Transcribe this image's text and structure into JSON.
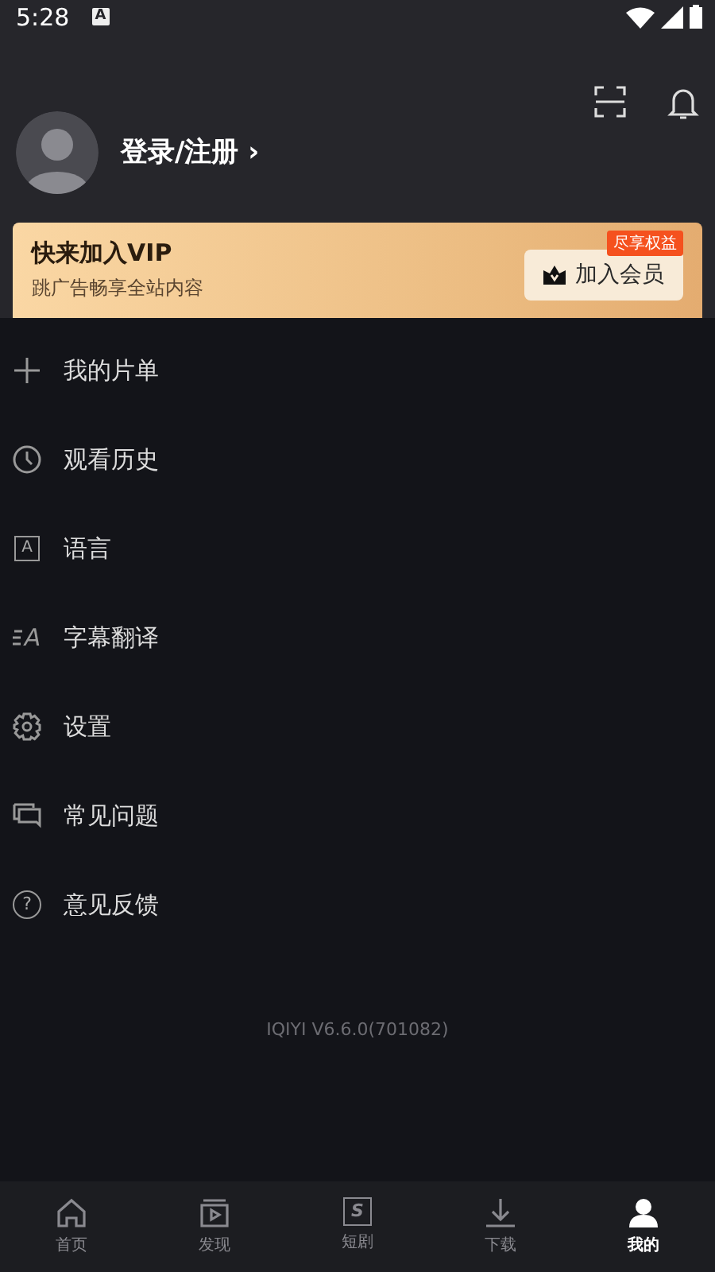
{
  "status_bar": {
    "time": "5:28",
    "notification_glyph": "A"
  },
  "profile": {
    "login": "登录/注册",
    "chevron": "›"
  },
  "vip_card": {
    "title": "快来加入VIP",
    "subtitle": "跳广告畅享全站内容",
    "badge": "尽享权益",
    "button": "加入会员"
  },
  "menu": [
    {
      "kind": "plus",
      "label": "我的片单"
    },
    {
      "kind": "clock",
      "label": "观看历史"
    },
    {
      "kind": "language",
      "label": "语言",
      "glyph": "A"
    },
    {
      "kind": "subtitle",
      "label": "字幕翻译",
      "glyph": "A"
    },
    {
      "kind": "gear",
      "label": "设置"
    },
    {
      "kind": "chat",
      "label": "常见问题"
    },
    {
      "kind": "help",
      "label": "意见反馈",
      "glyph": "?"
    }
  ],
  "version": "IQIYI V6.6.0(701082)",
  "tabs": [
    {
      "kind": "home",
      "label": "首页",
      "selected": false
    },
    {
      "kind": "discover",
      "label": "发现",
      "selected": false
    },
    {
      "kind": "shorts",
      "label": "短剧",
      "selected": false,
      "glyph": "S"
    },
    {
      "kind": "download",
      "label": "下载",
      "selected": false
    },
    {
      "kind": "me",
      "label": "我的",
      "selected": true
    }
  ]
}
